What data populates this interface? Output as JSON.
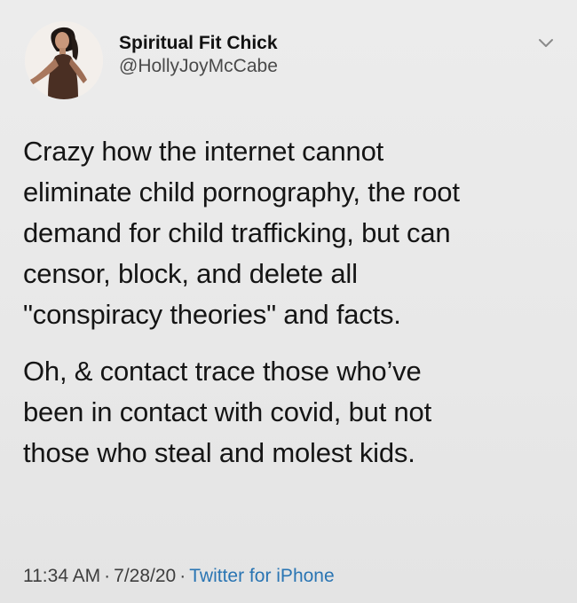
{
  "tweet": {
    "author": {
      "display_name": "Spiritual Fit Chick",
      "handle": "@HollyJoyMcCabe"
    },
    "menu_icon": "chevron-down-icon",
    "paragraphs": [
      "Crazy how the internet cannot\neliminate child pornography, the root\ndemand for child trafficking, but can\ncensor, block, and delete all\n\"conspiracy theories\" and facts.",
      "Oh, & contact trace those who’ve\nbeen in contact with covid, but not\nthose who steal and molest kids."
    ],
    "time": "11:34 AM",
    "date": "7/28/20",
    "separator": "·",
    "source": "Twitter for iPhone"
  },
  "colors": {
    "background": "#e9e9e9",
    "text": "#151515",
    "secondary_text": "#4a4a4a",
    "link": "#2a75b3"
  }
}
